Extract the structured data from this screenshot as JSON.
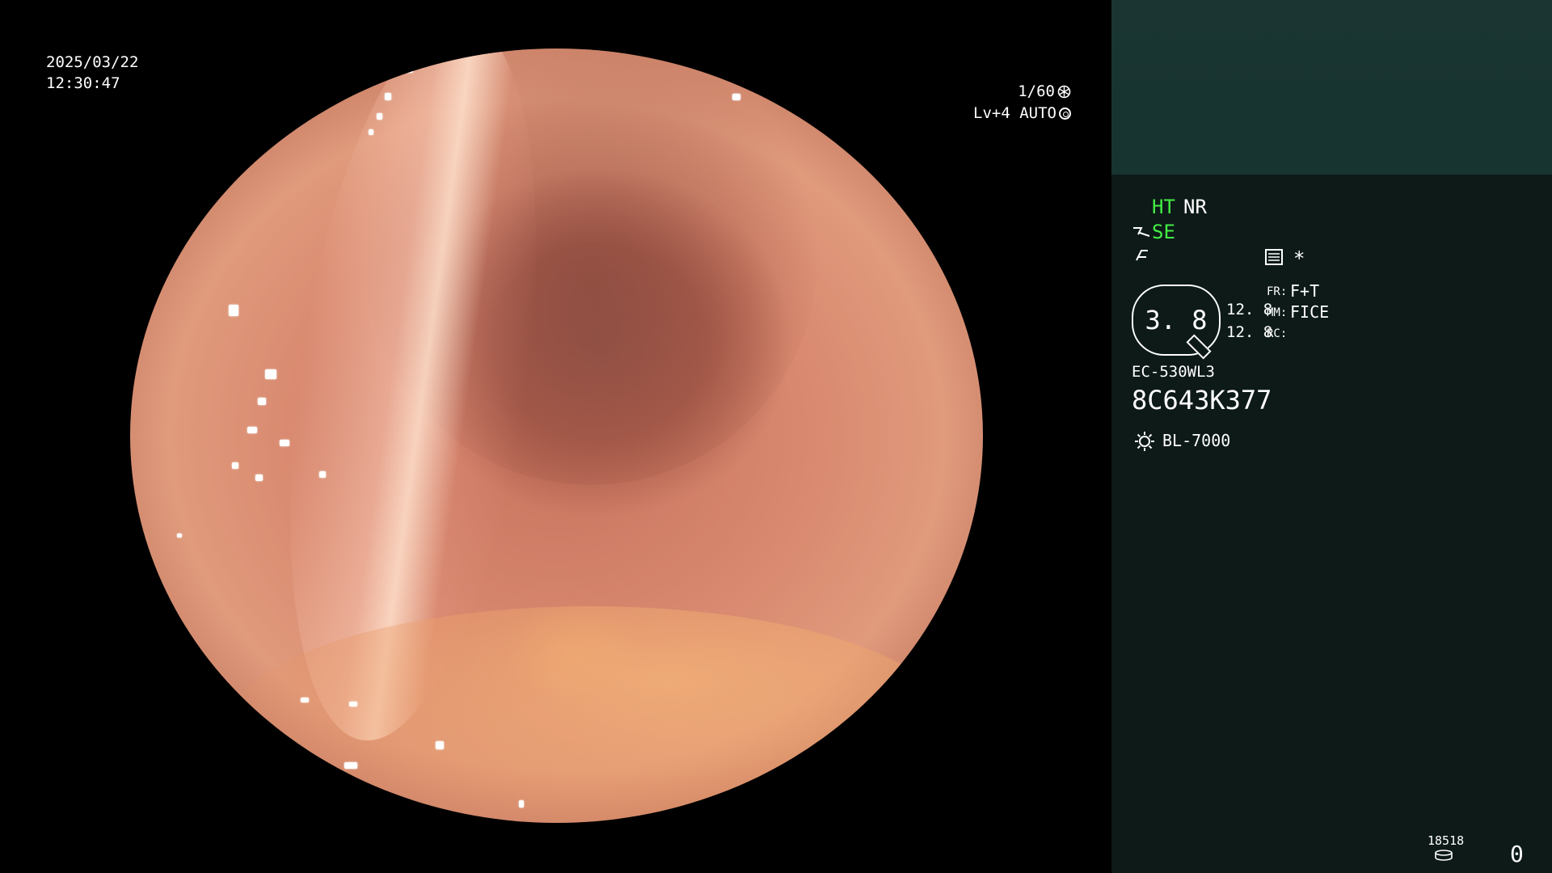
{
  "overlay": {
    "date": "2025/03/22",
    "time": "12:30:47",
    "shutter": "1/60",
    "level": "Lv+4 AUTO"
  },
  "panel": {
    "ht": "HT",
    "nr": "NR",
    "se": "SE",
    "asterisk": "*",
    "lens_value": "3. 8",
    "val1": "12. 8",
    "val2": "12. 8",
    "fr_label": "FR:",
    "fr_value": "F+T",
    "mm_label": "MM:",
    "mm_value": "FICE",
    "rc_label": "RC:",
    "scope_model": "EC-530WL3",
    "serial": "8C643K377",
    "light_source": "BL-7000",
    "storage_count": "18518",
    "capture_count": "0"
  },
  "colors": {
    "panel_top": "#1a3532",
    "panel_bg": "#0d1a18",
    "accent_green": "#44ee44"
  },
  "icons": [
    "aperture-icon",
    "auto-ring-icon",
    "scope-icon",
    "signal-icon",
    "menu-icon",
    "lens-icon",
    "sun-icon",
    "disk-icon"
  ]
}
